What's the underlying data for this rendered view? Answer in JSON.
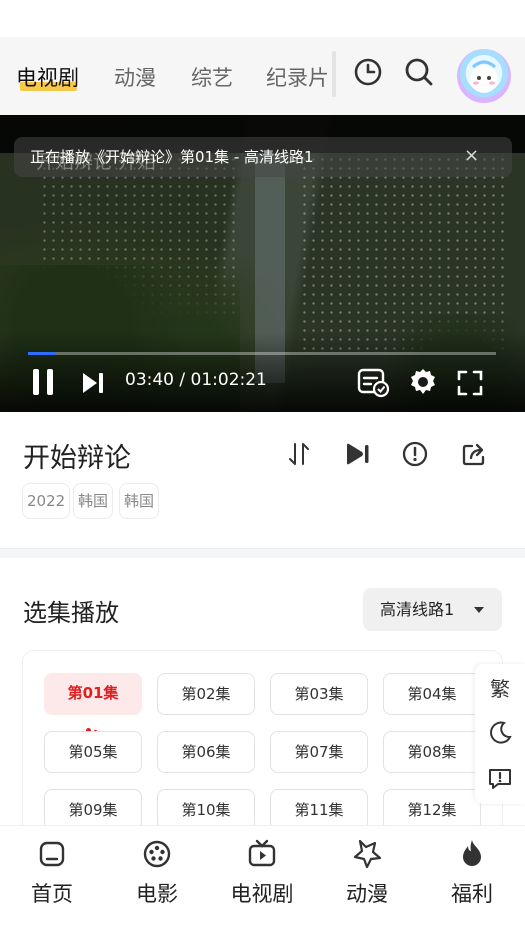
{
  "nav": {
    "tabs": [
      {
        "label": "电视剧",
        "active": true
      },
      {
        "label": "动漫",
        "active": false
      },
      {
        "label": "综艺",
        "active": false
      },
      {
        "label": "纪录片",
        "active": false
      }
    ],
    "icons": [
      "history-icon",
      "search-icon",
      "avatar"
    ]
  },
  "player": {
    "toast_ghost": "开始辩论 开始",
    "toast_text": "正在播放《开始辩论》第01集 - 高清线路1",
    "close_glyph": "×",
    "time": "03:40 / 01:02:21",
    "progress_fraction": 0.059,
    "accent": "#2f6bff"
  },
  "info": {
    "title": "开始辩论",
    "tags": [
      "2022",
      "韩国",
      "韩国"
    ],
    "actions": [
      "sort-icon",
      "next-episode-icon",
      "report-icon",
      "share-icon"
    ]
  },
  "episodes": {
    "section_title": "选集播放",
    "route_label": "高清线路1",
    "items": [
      "第01集",
      "第02集",
      "第03集",
      "第04集",
      "第05集",
      "第06集",
      "第07集",
      "第08集",
      "第09集",
      "第10集",
      "第11集",
      "第12集"
    ],
    "active_index": 0,
    "active_color": "#e02020"
  },
  "side_tools": {
    "traditional_label": "繁",
    "icons": [
      "moon-icon",
      "feedback-icon"
    ]
  },
  "bottom_nav": [
    {
      "label": "首页",
      "icon": "home-icon"
    },
    {
      "label": "电影",
      "icon": "film-reel-icon"
    },
    {
      "label": "电视剧",
      "icon": "tv-icon"
    },
    {
      "label": "动漫",
      "icon": "star-icon"
    },
    {
      "label": "福利",
      "icon": "flame-icon"
    }
  ]
}
